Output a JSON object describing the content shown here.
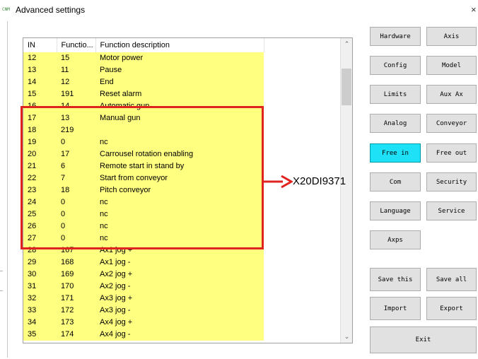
{
  "window": {
    "icon_text": "CNM",
    "title": "Advanced settings",
    "close_glyph": "×"
  },
  "table": {
    "columns": [
      "IN",
      "Functio...",
      "Function description"
    ],
    "rows": [
      {
        "in": "12",
        "func": "15",
        "desc": "Motor power"
      },
      {
        "in": "13",
        "func": "11",
        "desc": "Pause"
      },
      {
        "in": "14",
        "func": "12",
        "desc": "End"
      },
      {
        "in": "15",
        "func": "191",
        "desc": "Reset alarm"
      },
      {
        "in": "16",
        "func": "14",
        "desc": "Automatic gun"
      },
      {
        "in": "17",
        "func": "13",
        "desc": "Manual gun"
      },
      {
        "in": "18",
        "func": "219",
        "desc": ""
      },
      {
        "in": "19",
        "func": "0",
        "desc": "nc"
      },
      {
        "in": "20",
        "func": "17",
        "desc": "Carrousel rotation enabling"
      },
      {
        "in": "21",
        "func": "6",
        "desc": "Remote start in stand by"
      },
      {
        "in": "22",
        "func": "7",
        "desc": "Start from conveyor"
      },
      {
        "in": "23",
        "func": "18",
        "desc": "Pitch conveyor"
      },
      {
        "in": "24",
        "func": "0",
        "desc": "nc"
      },
      {
        "in": "25",
        "func": "0",
        "desc": "nc"
      },
      {
        "in": "26",
        "func": "0",
        "desc": "nc"
      },
      {
        "in": "27",
        "func": "0",
        "desc": "nc"
      },
      {
        "in": "28",
        "func": "167",
        "desc": "Ax1 jog +"
      },
      {
        "in": "29",
        "func": "168",
        "desc": "Ax1 jog -"
      },
      {
        "in": "30",
        "func": "169",
        "desc": "Ax2 jog +"
      },
      {
        "in": "31",
        "func": "170",
        "desc": "Ax2 jog -"
      },
      {
        "in": "32",
        "func": "171",
        "desc": "Ax3 jog +"
      },
      {
        "in": "33",
        "func": "172",
        "desc": "Ax3 jog -"
      },
      {
        "in": "34",
        "func": "173",
        "desc": "Ax4 jog +"
      },
      {
        "in": "35",
        "func": "174",
        "desc": "Ax4 jog -"
      }
    ],
    "row_color": "#ffff80",
    "scroll_up_glyph": "⌃",
    "scroll_down_glyph": "⌄"
  },
  "annotation": {
    "label": "X20DI9371",
    "color": "#e0231f"
  },
  "buttons": {
    "hardware": "Hardware",
    "axis": "Axis",
    "config": "Config",
    "model": "Model",
    "limits": "Limits",
    "aux_ax": "Aux Ax",
    "analog": "Analog",
    "conveyor": "Conveyor",
    "free_in": "Free in",
    "free_out": "Free out",
    "com": "Com",
    "security": "Security",
    "language": "Language",
    "service": "Service",
    "axps": "Axps",
    "save_this": "Save this",
    "save_all": "Save all",
    "import": "Import",
    "export": "Export",
    "exit": "Exit"
  },
  "colors": {
    "active_button": "#1ee0f6",
    "button_face": "#e1e1e1"
  }
}
